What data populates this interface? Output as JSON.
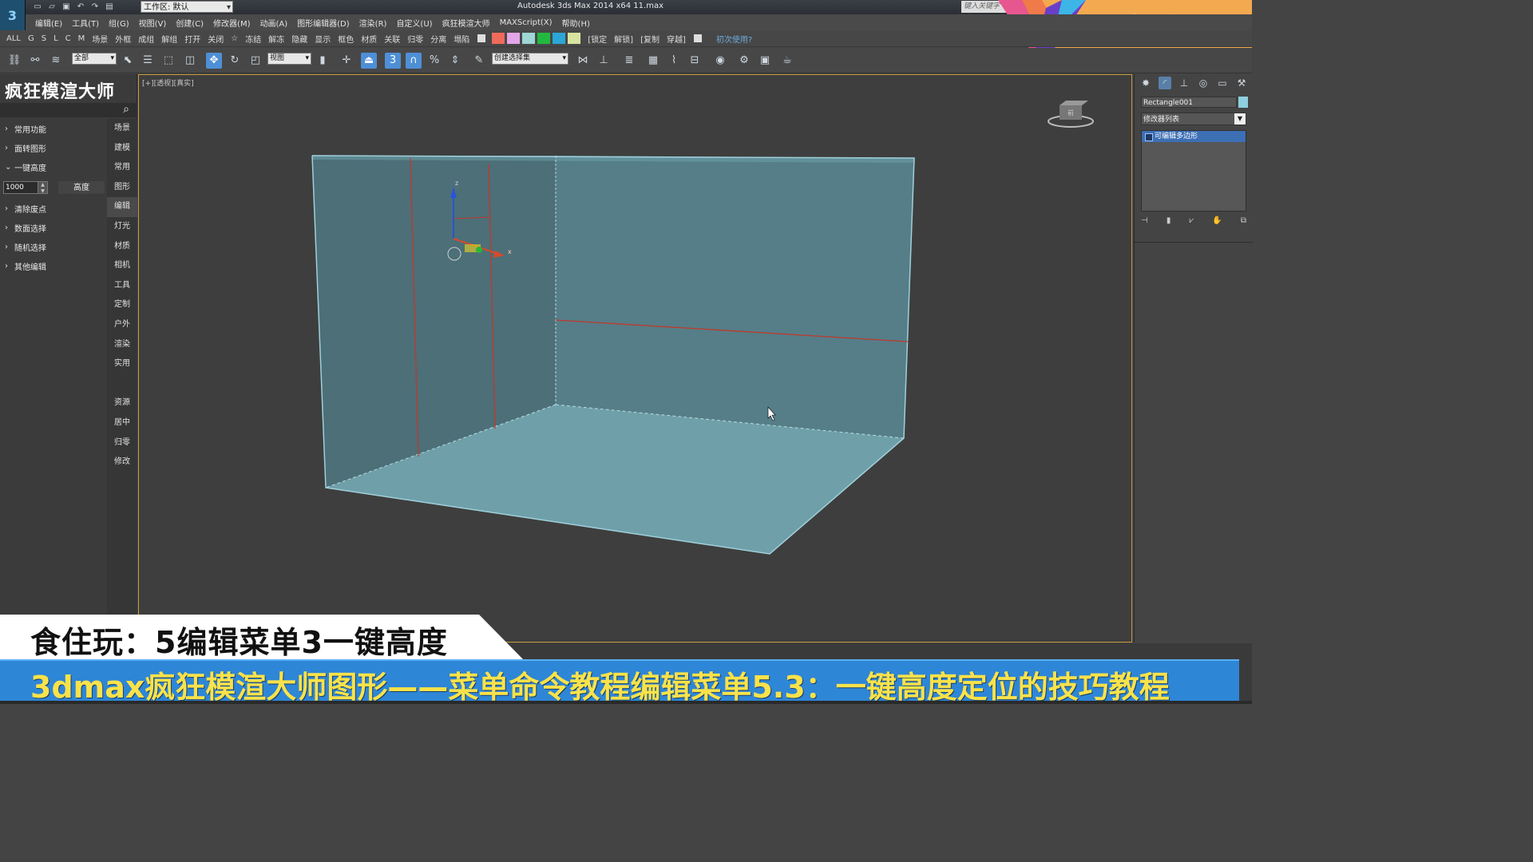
{
  "titlebar": {
    "workspace": "工作区: 默认",
    "title": "Autodesk 3ds Max  2014 x64     11.max",
    "search_placeholder": "键入关键字或..."
  },
  "menubar": [
    "编辑(E)",
    "工具(T)",
    "组(G)",
    "视图(V)",
    "创建(C)",
    "修改器(M)",
    "动画(A)",
    "图形编辑器(D)",
    "渲染(R)",
    "自定义(U)",
    "疯狂模渲大师",
    "MAXScript(X)",
    "帮助(H)"
  ],
  "pluginbar": {
    "left_items": [
      "ALL",
      "G",
      "S",
      "L",
      "C",
      "M"
    ],
    "items": [
      "场景",
      "外框",
      "成组",
      "解组",
      "打开",
      "关闭",
      "☆",
      "冻结",
      "解冻",
      "隐藏",
      "显示",
      "框色",
      "材质",
      "关联",
      "归零",
      "分离",
      "塌陷"
    ],
    "swatch_colors": [
      "#f06a5a",
      "#e3a6e8",
      "#9fd6d6",
      "#22b840",
      "#2aa7d6",
      "#d9e3a0"
    ],
    "right_items": [
      "[锁定",
      "解锁]",
      "[复制",
      "穿越]"
    ],
    "help": "初次使用?"
  },
  "maintoolbar": {
    "filter": "全部",
    "refcoord": "视图",
    "selset": "创建选择集"
  },
  "leftpanel": {
    "title": "疯狂模渲大师",
    "items": [
      {
        "label": "常用功能",
        "chev": "›"
      },
      {
        "label": "面转图形",
        "chev": "›"
      },
      {
        "label": "一键高度",
        "chev": "⌄"
      }
    ],
    "height_value": "1000",
    "height_button": "高度",
    "items2": [
      {
        "label": "清除废点",
        "chev": "›"
      },
      {
        "label": "数面选择",
        "chev": "›"
      },
      {
        "label": "随机选择",
        "chev": "›"
      },
      {
        "label": "其他编辑",
        "chev": "›"
      }
    ],
    "tabs": [
      "场景",
      "建模",
      "常用",
      "图形",
      "编辑",
      "灯光",
      "材质",
      "相机",
      "工具",
      "定制",
      "户外",
      "渲染",
      "实用",
      "",
      "资源",
      "居中",
      "归零",
      "修改"
    ],
    "selected_tab": "编辑"
  },
  "viewport": {
    "label": "[+][透视][真实]",
    "axis_x": "x",
    "axis_z": "z",
    "viewcube_label": "前"
  },
  "cmdpanel": {
    "object_name": "Rectangle001",
    "object_color": "#8ecfe0",
    "modifier_list": "修改器列表",
    "stack_item": "可编辑多边形"
  },
  "captions": {
    "line1": "食住玩：5编辑菜单3一键高度",
    "line2": "3dmax疯狂模渲大师图形——菜单命令教程编辑菜单5.3：一键高度定位的技巧教程"
  },
  "watermark": {
    "text": "食住玩"
  }
}
